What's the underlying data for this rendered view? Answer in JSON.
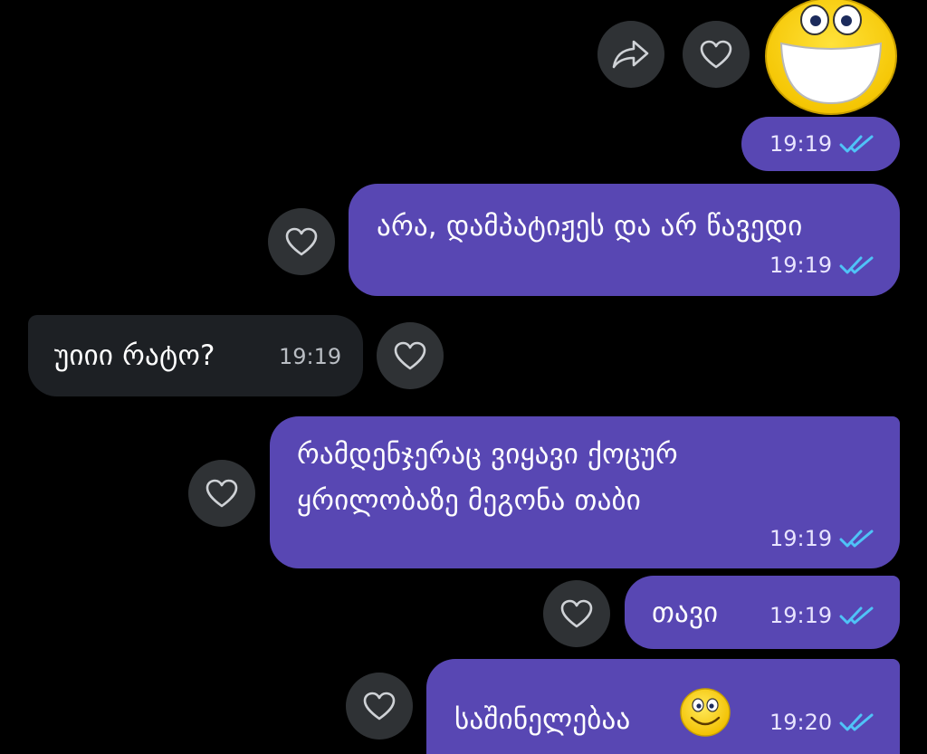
{
  "colors": {
    "background": "#000000",
    "outgoing_bubble": "#5847b3",
    "incoming_bubble": "#1d2024",
    "action_circle": "#2f3235",
    "read_ticks": "#4fc3f7"
  },
  "icons": {
    "forward": "forward-icon",
    "like": "heart-icon",
    "read": "double-check-icon",
    "sticker": "laughing-smiley-sticker",
    "emoji": "smiley-emoji"
  },
  "messages": [
    {
      "direction": "outgoing",
      "type": "sticker",
      "time": "19:19",
      "status": "read"
    },
    {
      "direction": "outgoing",
      "text": "არა, დამპატიჟეს და არ წავედი",
      "time": "19:19",
      "status": "read"
    },
    {
      "direction": "incoming",
      "text": "უიიი რატო?",
      "time": "19:19"
    },
    {
      "direction": "outgoing",
      "lines": [
        "რამდენჯერაც ვიყავი ქოცურ",
        "ყრილობაზე მეგონა თაბი"
      ],
      "time": "19:19",
      "status": "read"
    },
    {
      "direction": "outgoing",
      "text": "თავი",
      "time": "19:19",
      "status": "read"
    },
    {
      "direction": "outgoing",
      "text": "საშინელებაა",
      "emoji": "smiley",
      "time": "19:20",
      "status": "read"
    }
  ]
}
